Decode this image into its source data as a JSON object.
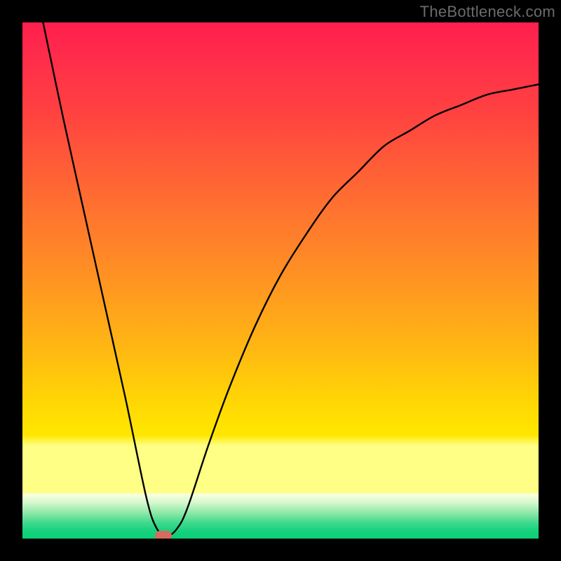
{
  "watermark": "TheBottleneck.com",
  "marker_color": "#d96a5e",
  "chart_data": {
    "type": "line",
    "title": "",
    "xlabel": "",
    "ylabel": "",
    "xlim": [
      0,
      100
    ],
    "ylim": [
      0,
      100
    ],
    "grid": false,
    "legend": false,
    "series": [
      {
        "name": "curve",
        "x": [
          4,
          8,
          12,
          16,
          20,
          24,
          26,
          28,
          30,
          32,
          36,
          40,
          45,
          50,
          55,
          60,
          65,
          70,
          75,
          80,
          85,
          90,
          95,
          100
        ],
        "y": [
          100,
          81,
          63,
          45,
          27,
          8,
          2,
          0.5,
          2,
          6,
          18,
          29,
          41,
          51,
          59,
          66,
          71,
          76,
          79,
          82,
          84,
          86,
          87,
          88
        ]
      }
    ],
    "annotations": [
      {
        "name": "min-marker",
        "x": 27.3,
        "y": 0.6
      }
    ]
  }
}
